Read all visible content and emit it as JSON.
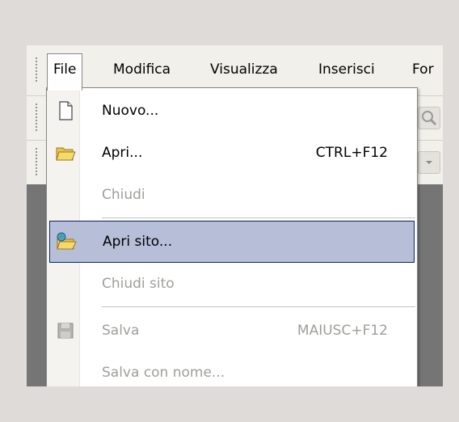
{
  "menubar": {
    "items": [
      "File",
      "Modifica",
      "Visualizza",
      "Inserisci",
      "For"
    ]
  },
  "file_menu": {
    "items": [
      {
        "label": "Nuovo...",
        "shortcut": "",
        "icon": "new-document-icon",
        "state": "enabled"
      },
      {
        "label": "Apri...",
        "shortcut": "CTRL+F12",
        "icon": "open-folder-icon",
        "state": "enabled"
      },
      {
        "label": "Chiudi",
        "shortcut": "",
        "icon": "",
        "state": "disabled"
      },
      {
        "label": "Apri sito...",
        "shortcut": "",
        "icon": "open-site-icon",
        "state": "highlighted"
      },
      {
        "label": "Chiudi sito",
        "shortcut": "",
        "icon": "",
        "state": "disabled"
      },
      {
        "label": "Salva",
        "shortcut": "MAIUSC+F12",
        "icon": "save-disk-icon",
        "state": "disabled"
      },
      {
        "label": "Salva con nome...",
        "shortcut": "",
        "icon": "",
        "state": "disabled"
      }
    ]
  },
  "colors": {
    "highlight_bg": "#b7bfd8",
    "highlight_border": "#0a246a",
    "disabled_text": "#a09e9a"
  }
}
